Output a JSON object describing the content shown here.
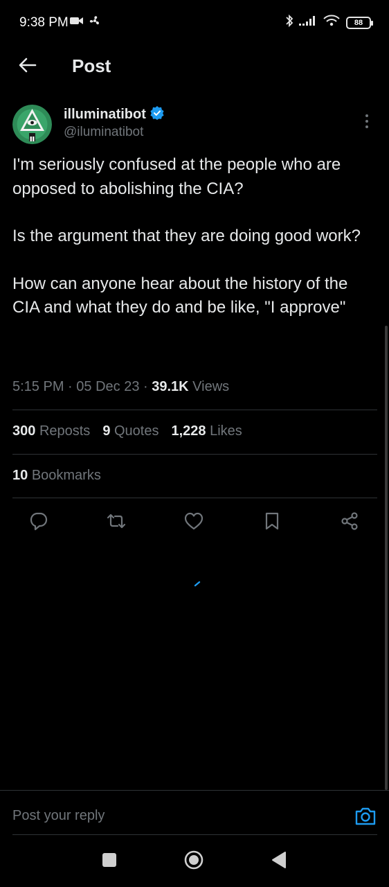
{
  "status_bar": {
    "time": "9:38 PM",
    "battery": "88",
    "icons": [
      "video-camera-icon",
      "fan-icon",
      "bluetooth-icon",
      "signal-icon",
      "wifi-icon",
      "battery-icon"
    ]
  },
  "header": {
    "title": "Post",
    "back_icon": "arrow-left-icon"
  },
  "post": {
    "author_name": "illuminatibot",
    "author_handle": "@iluminatibot",
    "verified": true,
    "paragraphs": [
      "I'm seriously confused at the people who are opposed to abolishing the CIA?",
      "Is the argument that they are doing good work?",
      "How can anyone hear about the history of the CIA and what they do and be like, \"I approve\""
    ],
    "time": "5:15 PM",
    "separator": " · ",
    "date": "05 Dec 23",
    "views_count": "39.1K",
    "views_label": "Views"
  },
  "stats": {
    "reposts_count": "300",
    "reposts_label": "Reposts",
    "quotes_count": "9",
    "quotes_label": "Quotes",
    "likes_count": "1,228",
    "likes_label": "Likes",
    "bookmarks_count": "10",
    "bookmarks_label": "Bookmarks"
  },
  "actions": [
    "reply-icon",
    "repost-icon",
    "like-icon",
    "bookmark-icon",
    "share-icon"
  ],
  "reply_bar": {
    "placeholder": "Post your reply"
  },
  "colors": {
    "background": "#000000",
    "text_primary": "#e7e9ea",
    "text_secondary": "#71767b",
    "accent": "#1d9bf0",
    "divider": "#2f3336"
  }
}
